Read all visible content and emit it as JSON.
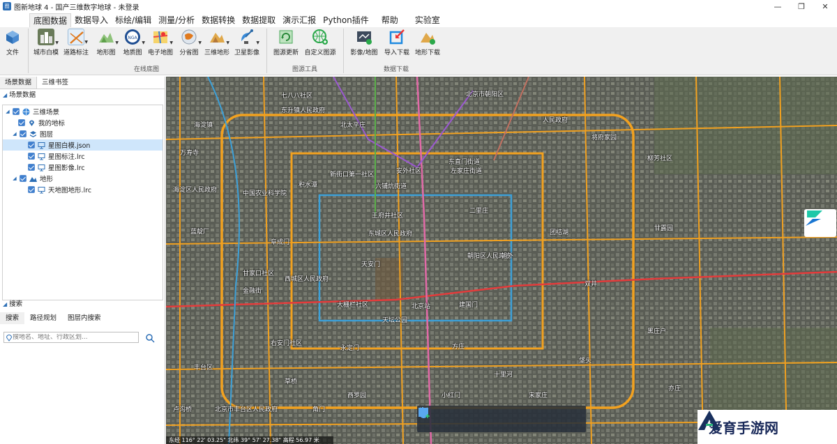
{
  "window": {
    "title": "图新地球 4 - 国产三维数字地球 - 未登录",
    "controls": [
      "—",
      "❐",
      "✕"
    ]
  },
  "menu": {
    "tabs": [
      "底图数据",
      "数据导入",
      "标绘/编辑",
      "测量/分析",
      "数据转换",
      "数据提取",
      "演示汇报",
      "Python插件",
      "帮助",
      "实验室"
    ],
    "active": "底图数据"
  },
  "ribbon": {
    "file_label": "文件",
    "online_basemap": [
      "城市白模",
      "道路标注",
      "地形图",
      "地质图",
      "电子地图",
      "分省图",
      "三维地形",
      "卫星影像"
    ],
    "source_tools": [
      "图源更新",
      "自定义图源"
    ],
    "data_download": [
      "影像/地图",
      "导入下载",
      "地形下载"
    ],
    "groups": [
      "在线底图",
      "图源工具",
      "数据下载"
    ]
  },
  "left_panel": {
    "tabs": [
      "场景数据",
      "三维书签"
    ],
    "section_title": "场景数据",
    "tree": [
      {
        "label": "三维场景",
        "level": 0,
        "expanded": true,
        "icon": "globe-icon"
      },
      {
        "label": "我的地标",
        "level": 1,
        "icon": "pin-icon"
      },
      {
        "label": "图层",
        "level": 1,
        "expanded": true,
        "icon": "layers-icon"
      },
      {
        "label": "星图白模.json",
        "level": 2,
        "icon": "monitor-icon",
        "selected": true
      },
      {
        "label": "星图标注.lrc",
        "level": 2,
        "icon": "monitor-icon"
      },
      {
        "label": "星图影像.lrc",
        "level": 2,
        "icon": "monitor-icon"
      },
      {
        "label": "地形",
        "level": 1,
        "expanded": true,
        "icon": "terrain-icon"
      },
      {
        "label": "天地图地形.lrc",
        "level": 2,
        "icon": "monitor-icon"
      }
    ],
    "search": {
      "title": "搜索",
      "tabs": [
        "搜索",
        "路径规划",
        "图层内搜索"
      ],
      "placeholder": "搜地名、地址、行政区划..."
    }
  },
  "map": {
    "labels": [
      "七八八社区",
      "海淀镇",
      "东升镇人民政府",
      "北京市朝阳区",
      "人民政府",
      "北太平庄",
      "将府家园",
      "海淀区人民政府",
      "新街口第一社区",
      "安外社区",
      "东直门街道",
      "中国农业科学院",
      "积水潭",
      "六铺炕街道",
      "柳芳社区",
      "左家庄街道",
      "二里庄",
      "王府井社区",
      "东城区人民政府",
      "朝阳区人民政府",
      "团结湖",
      "甘家口社区",
      "西城区人民政府",
      "金融街",
      "天安门",
      "大栅栏社区",
      "北京站",
      "双井",
      "丰台区",
      "右安门社区",
      "永定门",
      "垡头",
      "方庄",
      "北京市丰台区人民政府",
      "天坛公园",
      "宋家庄",
      "十里河",
      "蓝靛厂",
      "阜成门",
      "朝外",
      "建国门",
      "草桥",
      "亦庄",
      "黑庄户",
      "小红门",
      "西罗园",
      "角门",
      "卢沟桥",
      "万寿寺",
      "甘露园"
    ],
    "status": "东经 116° 22' 03.25\" 北纬 39° 57' 27.38\" 高程 56.97 米",
    "watermark": "爱育手游网"
  },
  "colors": {
    "accent": "#2d6fb6",
    "ribbon_bg": "#f0f0f0",
    "road": "#f2a11f",
    "metro_red": "#e43b3b"
  }
}
